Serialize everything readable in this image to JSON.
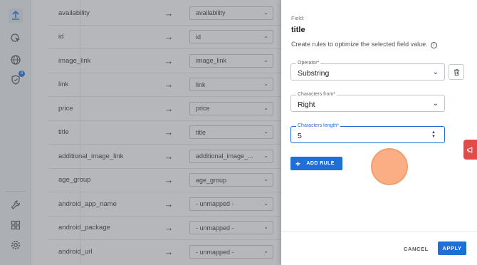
{
  "rail": {
    "icons": [
      "upload-icon",
      "cursor-search-icon",
      "globe-icon",
      "shield-icon",
      "wrench-icon",
      "grid-icon",
      "gear-icon"
    ],
    "badge": "8"
  },
  "mapping": {
    "rows": [
      {
        "field": "availability",
        "value": "availability"
      },
      {
        "field": "id",
        "value": "id"
      },
      {
        "field": "image_link",
        "value": "image_link"
      },
      {
        "field": "link",
        "value": "link"
      },
      {
        "field": "price",
        "value": "price"
      },
      {
        "field": "title",
        "value": "title"
      },
      {
        "field": "additional_image_link",
        "value": "additional_image_..."
      },
      {
        "field": "age_group",
        "value": "age_group"
      },
      {
        "field": "android_app_name",
        "value": "- unmapped -"
      },
      {
        "field": "android_package",
        "value": "- unmapped -"
      },
      {
        "field": "android_url",
        "value": "- unmapped -"
      }
    ]
  },
  "panel": {
    "field_label": "Field:",
    "field_value": "title",
    "description": "Create rules to optimize the selected field value.",
    "operator": {
      "label": "Operator*",
      "value": "Substring"
    },
    "chars_from": {
      "label": "Characters from*",
      "value": "Right"
    },
    "chars_length": {
      "label": "Characters length*",
      "value": "5"
    },
    "add_rule": "ADD RULE",
    "cancel": "CANCEL",
    "apply": "APPLY"
  },
  "colors": {
    "accent": "#1f6fd6",
    "feedback": "#e34b4b"
  }
}
